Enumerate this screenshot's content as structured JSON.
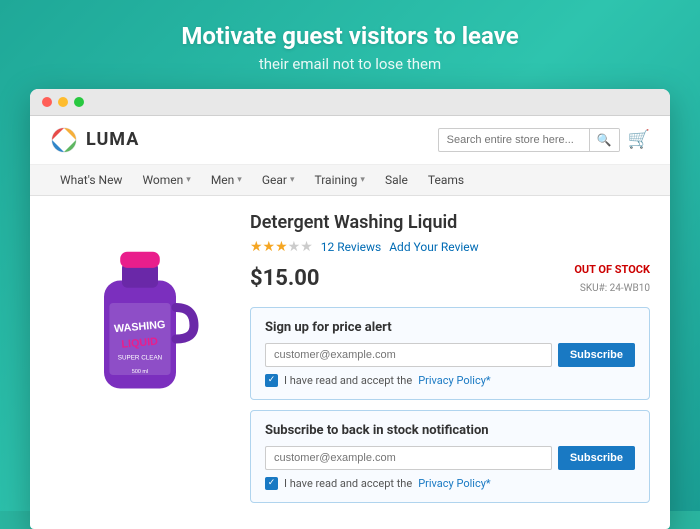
{
  "promo": {
    "title": "Motivate guest visitors to leave",
    "subtitle": "their email not to lose them"
  },
  "browser": {
    "dots": [
      "red",
      "yellow",
      "green"
    ]
  },
  "store": {
    "logo_text": "LUMA",
    "search_placeholder": "Search entire store here...",
    "nav_items": [
      {
        "label": "What's New",
        "has_chevron": false
      },
      {
        "label": "Women",
        "has_chevron": true
      },
      {
        "label": "Men",
        "has_chevron": true
      },
      {
        "label": "Gear",
        "has_chevron": true
      },
      {
        "label": "Training",
        "has_chevron": true
      },
      {
        "label": "Sale",
        "has_chevron": false
      },
      {
        "label": "Teams",
        "has_chevron": false
      }
    ]
  },
  "product": {
    "title": "Detergent Washing Liquid",
    "stars_filled": 3,
    "stars_empty": 2,
    "review_count": "12 Reviews",
    "add_review": "Add Your Review",
    "price": "$15.00",
    "stock_status": "OUT OF STOCK",
    "sku_label": "SKU#: 24-WB10"
  },
  "price_alert": {
    "title": "Sign up for price alert",
    "email_placeholder": "customer@example.com",
    "subscribe_label": "Subscribe",
    "policy_text": "I have read and accept the ",
    "policy_link": "Privacy Policy*"
  },
  "stock_alert": {
    "title": "Subscribe to back in stock notification",
    "email_placeholder": "customer@example.com",
    "subscribe_label": "Subscribe",
    "policy_text": "I have read and accept the ",
    "policy_link": "Privacy Policy*"
  }
}
